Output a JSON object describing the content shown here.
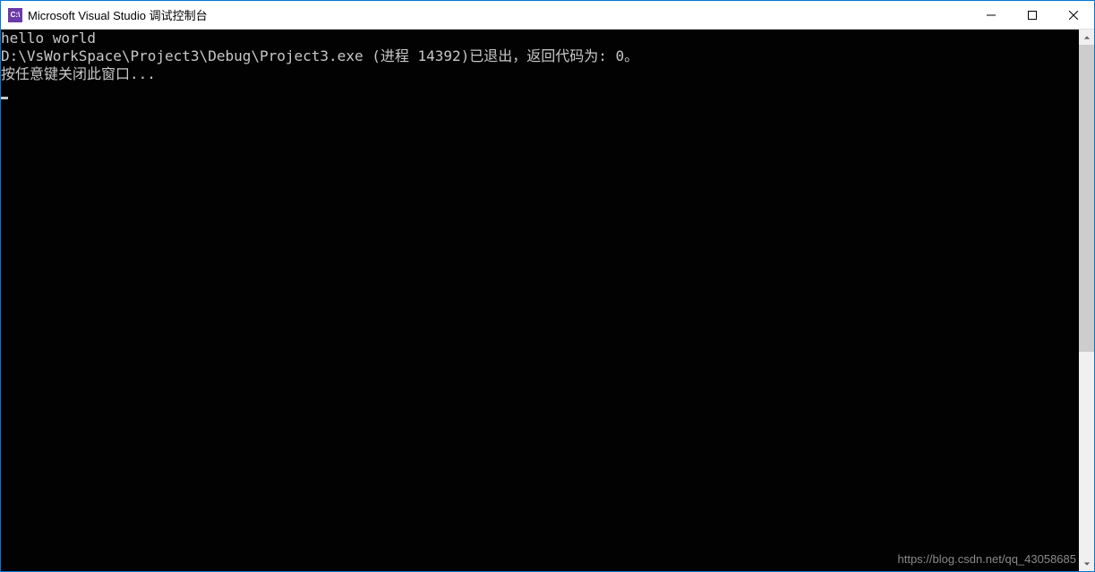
{
  "titlebar": {
    "icon_text": "C:\\",
    "title": "Microsoft Visual Studio 调试控制台"
  },
  "console": {
    "lines": [
      "hello world",
      "D:\\VsWorkSpace\\Project3\\Debug\\Project3.exe (进程 14392)已退出，返回代码为: 0。",
      "按任意键关闭此窗口..."
    ]
  },
  "watermark": "https://blog.csdn.net/qq_43058685"
}
